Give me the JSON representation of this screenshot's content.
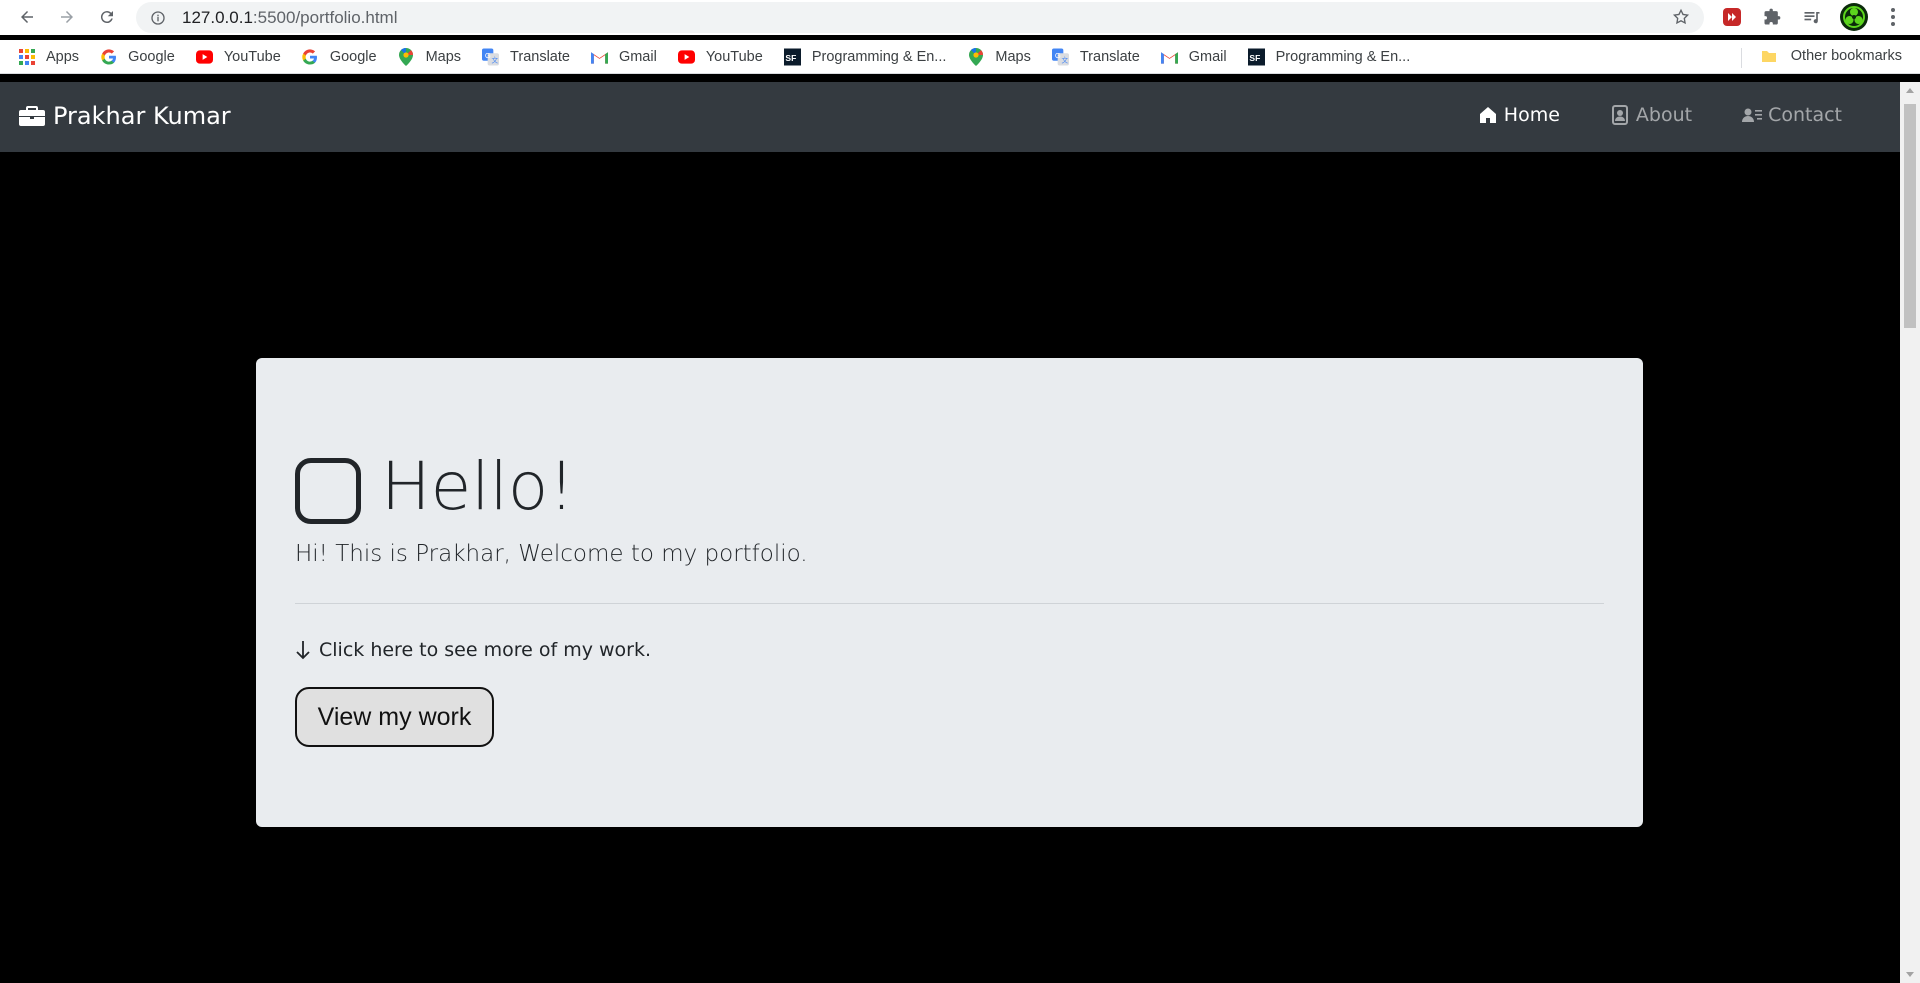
{
  "browser": {
    "url_host": "127.0.0.1",
    "url_path": ":5500/portfolio.html",
    "bookmarks": [
      {
        "label": "Apps",
        "icon": "apps-grid-icon"
      },
      {
        "label": "Google",
        "icon": "google-icon"
      },
      {
        "label": "YouTube",
        "icon": "youtube-icon"
      },
      {
        "label": "Google",
        "icon": "google-icon"
      },
      {
        "label": "Maps",
        "icon": "maps-icon"
      },
      {
        "label": "Translate",
        "icon": "translate-icon"
      },
      {
        "label": "Gmail",
        "icon": "gmail-icon"
      },
      {
        "label": "YouTube",
        "icon": "youtube-icon"
      },
      {
        "label": "Programming & En...",
        "icon": "sf-icon"
      },
      {
        "label": "Maps",
        "icon": "maps-icon"
      },
      {
        "label": "Translate",
        "icon": "translate-icon"
      },
      {
        "label": "Gmail",
        "icon": "gmail-icon"
      },
      {
        "label": "Programming & En...",
        "icon": "sf-icon"
      }
    ],
    "other_bookmarks": "Other bookmarks"
  },
  "navbar": {
    "brand": "Prakhar Kumar",
    "links": [
      {
        "label": "Home",
        "active": true
      },
      {
        "label": "About",
        "active": false
      },
      {
        "label": "Contact",
        "active": false
      }
    ]
  },
  "hero": {
    "heading": "Hello!",
    "lead": "Hi! This is Prakhar, Welcome to my portfolio.",
    "more_text": "Click here to see more of my work.",
    "button_label": "View my work"
  },
  "colors": {
    "navbar_bg": "#343a40",
    "page_bg": "#000000",
    "jumbotron_bg": "#e9ecef",
    "text": "#212529"
  }
}
